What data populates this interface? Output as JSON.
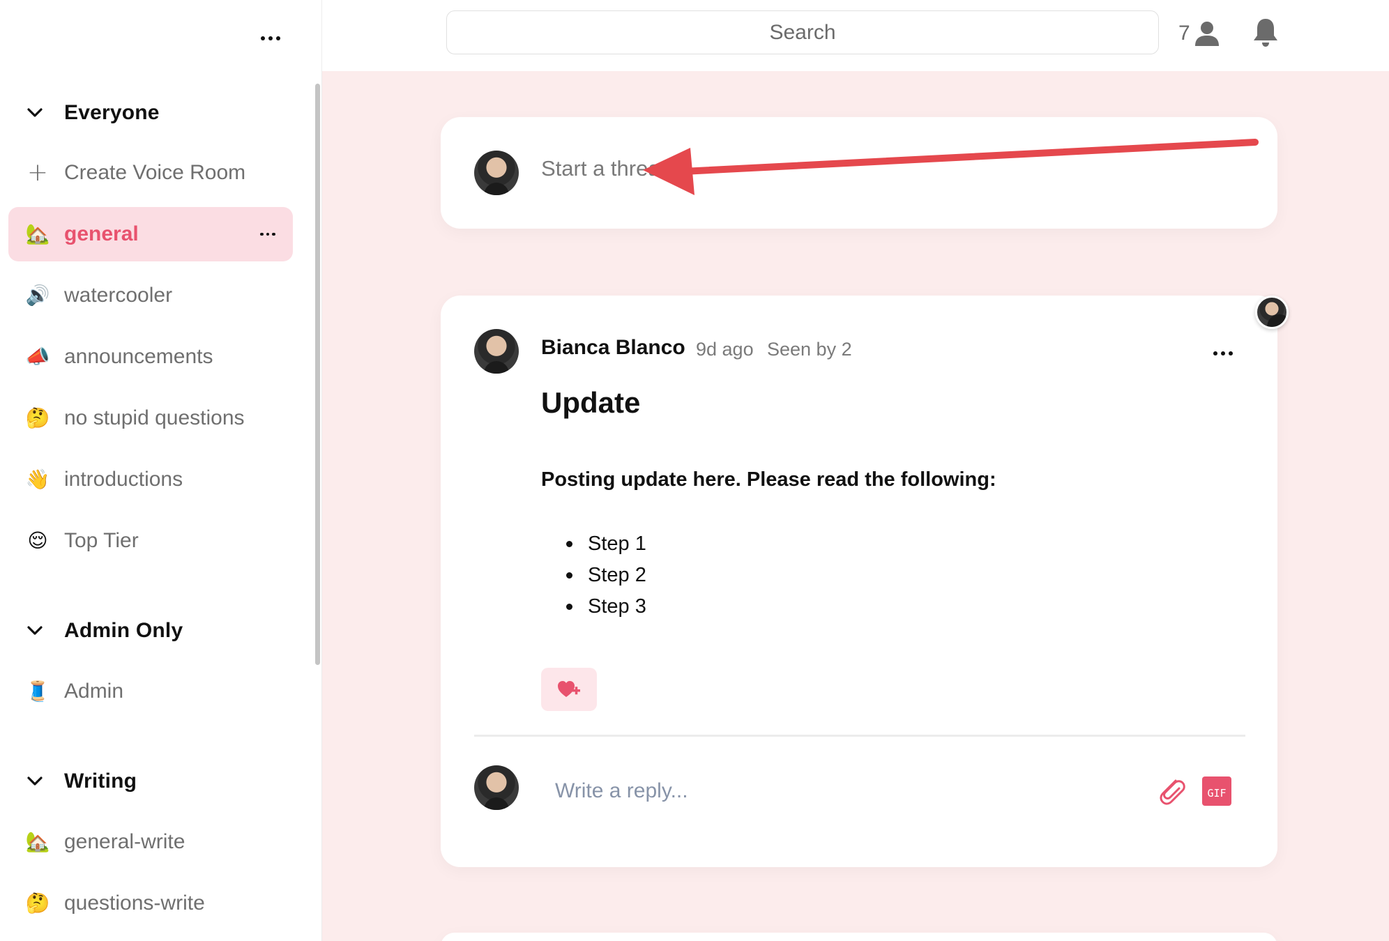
{
  "header": {
    "search_placeholder": "Search",
    "member_count": "7",
    "icons": {
      "members": "person-icon",
      "notifications": "bell-icon"
    }
  },
  "sidebar": {
    "sections": [
      {
        "title": "Everyone",
        "create_label": "Create Voice Room",
        "items": [
          {
            "emoji": "🏡",
            "label": "general",
            "active": true
          },
          {
            "emoji": "🔊",
            "label": "watercooler"
          },
          {
            "emoji": "📣",
            "label": "announcements"
          },
          {
            "emoji": "🤔",
            "label": "no stupid questions"
          },
          {
            "emoji": "👋",
            "label": "introductions"
          },
          {
            "emoji": "😌",
            "label": "Top Tier"
          }
        ]
      },
      {
        "title": "Admin Only",
        "items": [
          {
            "emoji": "🧵",
            "label": "Admin"
          }
        ]
      },
      {
        "title": "Writing",
        "items": [
          {
            "emoji": "🏡",
            "label": "general-write"
          },
          {
            "emoji": "🤔",
            "label": "questions-write"
          }
        ]
      }
    ]
  },
  "composer": {
    "placeholder": "Start a thread"
  },
  "post": {
    "author": "Bianca Blanco",
    "time": "9d ago",
    "seen": "Seen by 2",
    "title": "Update",
    "body": "Posting update here. Please read the following:",
    "steps": [
      "Step 1",
      "Step 2",
      "Step 3"
    ],
    "reply_placeholder": "Write a reply...",
    "gif_label": "GIF"
  },
  "colors": {
    "accent": "#e8526e",
    "active_bg": "#fbdde3",
    "page_bg": "#fcecec",
    "annotation_arrow": "#e5484d"
  }
}
